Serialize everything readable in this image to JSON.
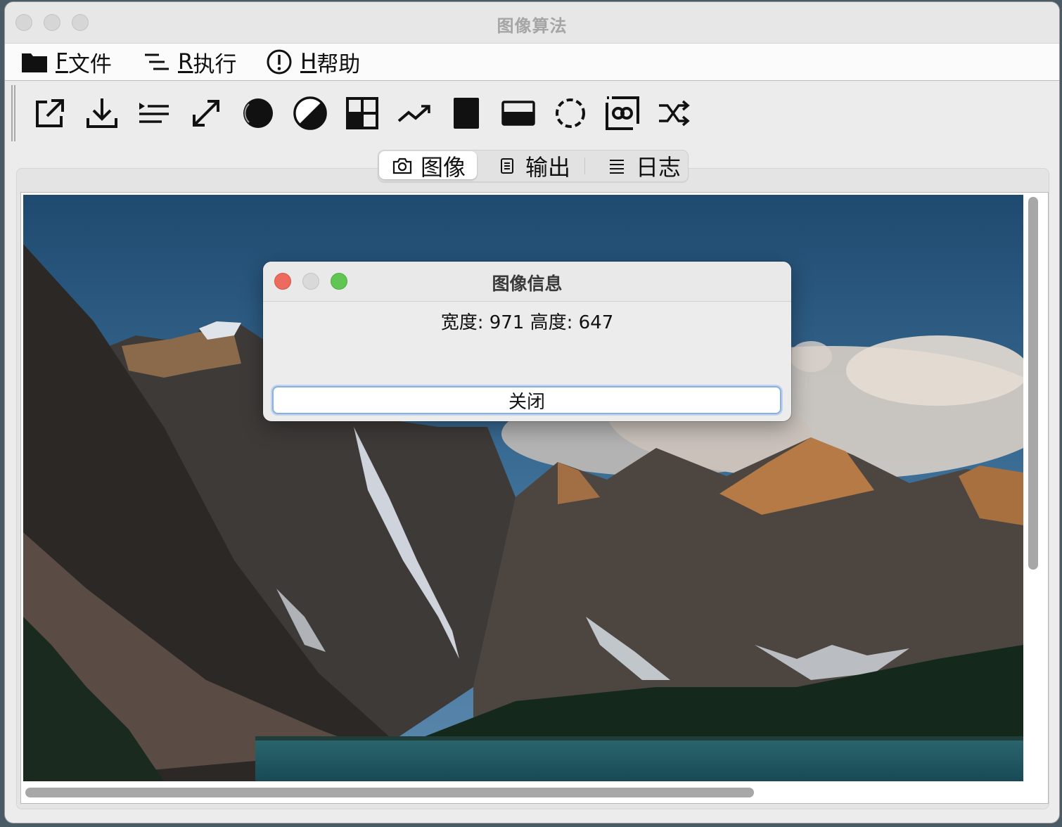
{
  "window": {
    "title": "图像算法"
  },
  "menubar": {
    "items": [
      {
        "mnemonic": "F",
        "label": "文件",
        "icon": "folder-icon"
      },
      {
        "mnemonic": "R",
        "label": "执行",
        "icon": "list-run-icon"
      },
      {
        "mnemonic": "H",
        "label": "帮助",
        "icon": "exclamation-circle-icon"
      }
    ]
  },
  "toolbar": {
    "tools": [
      "open-external-icon",
      "download-icon",
      "indent-list-icon",
      "expand-arrows-icon",
      "circle-filled-icon",
      "contrast-icon",
      "grid-icon",
      "trend-icon",
      "black-rect-icon",
      "half-rect-icon",
      "rotate-icon",
      "image-link-icon",
      "shuffle-icon"
    ]
  },
  "tabs": [
    {
      "label": "图像",
      "icon": "camera-icon",
      "selected": true
    },
    {
      "label": "输出",
      "icon": "document-icon",
      "selected": false
    },
    {
      "label": "日志",
      "icon": "lines-icon",
      "selected": false
    }
  ],
  "dialog": {
    "title": "图像信息",
    "info": "宽度: 971 高度: 647",
    "button_label": "关闭"
  },
  "colors": {
    "close": "#ec6a5e",
    "minimize": "#d9d9d9",
    "zoom": "#61c554",
    "button_focus": "#87b0e8"
  }
}
